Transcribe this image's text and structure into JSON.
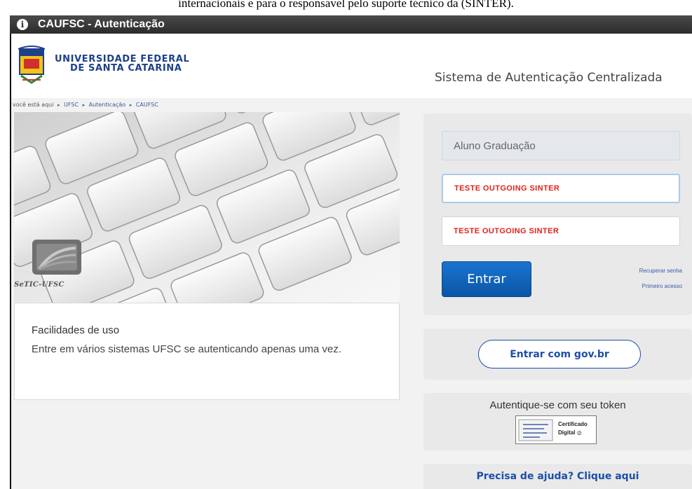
{
  "caption": "internacionais e para o responsável pelo suporte técnico  da (SINTER).",
  "window": {
    "title": "CAUFSC - Autenticação",
    "icon": "info-icon"
  },
  "header": {
    "logo_icon": "ufsc-crest-icon",
    "university_line1": "UNIVERSIDADE FEDERAL",
    "university_line2": "DE SANTA CATARINA",
    "system_title": "Sistema de Autenticação Centralizada"
  },
  "breadcrumb": {
    "prefix": "você está aqui",
    "items": [
      "UFSC",
      "Autenticação",
      "CAUFSC"
    ]
  },
  "hero": {
    "image": "keyboard-photo",
    "logo_icon": "setic-logo-icon",
    "logo_label": "SeTIC-UFSC"
  },
  "info_card": {
    "title": "Facilidades de uso",
    "text": "Entre em vários sistemas UFSC se autenticando apenas uma vez."
  },
  "login": {
    "profile_value": "Aluno Graduação",
    "username_value": "TESTE OUTGOING SINTER",
    "password_value": "TESTE OUTGOING SINTER",
    "submit_label": "Entrar",
    "recover_link": "Recuperar senha",
    "first_access_link": "Primeiro acesso"
  },
  "gov": {
    "button_prefix": "Entrar com ",
    "button_brand": "gov.br"
  },
  "token": {
    "title": "Autentique-se com seu token",
    "cert_line1": "Certificado",
    "cert_line2": "Digital"
  },
  "help": {
    "link": "Precisa de ajuda? Clique aqui"
  },
  "colors": {
    "titlebar": "#2c2c2c",
    "brand_blue": "#1e3f8a",
    "button_blue": "#0a56a6",
    "test_red": "#e0201b",
    "panel_gray": "#e9e9e9"
  }
}
